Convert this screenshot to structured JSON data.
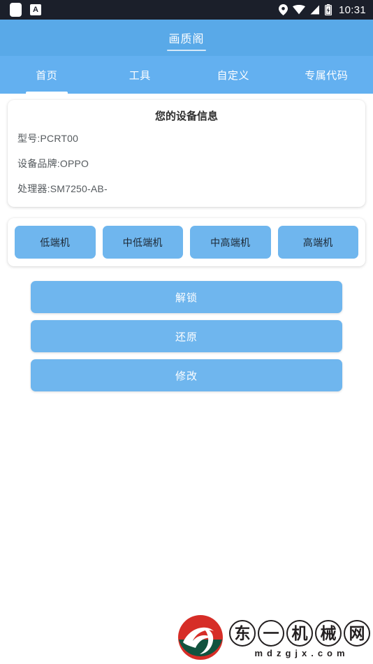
{
  "status_bar": {
    "left_icons": [
      "blank-notification-icon",
      "a-app-icon"
    ],
    "a_icon_label": "A",
    "right_icons": [
      "location-pin-icon",
      "wifi-icon",
      "cellular-signal-icon",
      "battery-charging-icon"
    ],
    "time": "10:31"
  },
  "app_bar": {
    "title": "画质阁"
  },
  "tabs": [
    {
      "label": "首页",
      "active": true
    },
    {
      "label": "工具",
      "active": false
    },
    {
      "label": "自定义",
      "active": false
    },
    {
      "label": "专属代码",
      "active": false
    }
  ],
  "device_card": {
    "title": "您的设备信息",
    "rows": [
      "型号:PCRT00",
      "设备品牌:OPPO",
      "处理器:SM7250-AB-"
    ]
  },
  "tier_buttons": [
    {
      "label": "低端机"
    },
    {
      "label": "中低端机"
    },
    {
      "label": "中高端机"
    },
    {
      "label": "高端机"
    }
  ],
  "action_buttons": [
    {
      "label": "解锁"
    },
    {
      "label": "还原"
    },
    {
      "label": "修改"
    }
  ],
  "watermark": {
    "logo_name": "dongyi-jixie-logo",
    "circle_chars": [
      "东",
      "一",
      "机",
      "械",
      "网"
    ],
    "domain": "mdzgjx.com"
  },
  "colors": {
    "status_bar_bg": "#1b1f2a",
    "app_bar_bg": "#59a9e8",
    "tab_bar_bg": "#63b0f0",
    "button_blue": "#6fb6ee",
    "page_bg": "#ffffff",
    "logo_red": "#d62d27",
    "logo_green": "#11533f"
  }
}
